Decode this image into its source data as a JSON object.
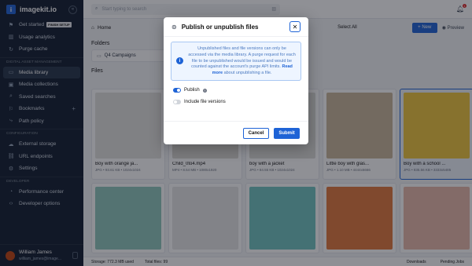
{
  "app": {
    "logo_letter": "i",
    "name": "imagekit.io"
  },
  "sidebar": {
    "items_top": [
      {
        "label": "Get started",
        "badge": "FINISH SETUP",
        "icon": "rocket-icon"
      },
      {
        "label": "Usage analytics",
        "icon": "chart-icon"
      },
      {
        "label": "Purge cache",
        "icon": "refresh-icon"
      }
    ],
    "section_dam": "DIGITAL ASSET MANAGEMENT",
    "items_dam": [
      {
        "label": "Media library",
        "icon": "folder-icon",
        "active": true
      },
      {
        "label": "Media collections",
        "icon": "collection-icon"
      },
      {
        "label": "Saved searches",
        "icon": "bookmark-search-icon"
      },
      {
        "label": "Bookmarks",
        "icon": "bookmark-icon",
        "plus": "+"
      },
      {
        "label": "Path policy",
        "icon": "path-icon"
      }
    ],
    "section_config": "CONFIGURATION",
    "items_config": [
      {
        "label": "External storage",
        "icon": "storage-icon"
      },
      {
        "label": "URL endpoints",
        "icon": "link-icon"
      },
      {
        "label": "Settings",
        "icon": "gear-icon"
      }
    ],
    "section_dev": "DEVELOPER",
    "items_dev": [
      {
        "label": "Performance center",
        "icon": "gauge-icon"
      },
      {
        "label": "Developer options",
        "icon": "code-icon"
      }
    ],
    "user": {
      "name": "William James",
      "email": "william_james@image..."
    }
  },
  "topbar": {
    "search_placeholder": "Start typing to search",
    "notifications": "1"
  },
  "toolbar": {
    "breadcrumb": "Home",
    "select_all": "Select All",
    "new_label": "New",
    "preview_label": "Preview"
  },
  "folders": {
    "title": "Folders",
    "items": [
      "Q4 Campaigns"
    ]
  },
  "files": {
    "title": "Files",
    "items": [
      {
        "name": "Boy with orange ja...",
        "meta": "JPG • 93.61 KB • 1024x1024",
        "color": "#e3e3df"
      },
      {
        "name": "Child_0to4.mp4",
        "meta": "MP4 • 8.54 MB • 1080x1920",
        "color": "#d8d6d1"
      },
      {
        "name": "boy with a jacket",
        "meta": "JPG • 84.55 KB • 1024x1024",
        "color": "#dcdcd8"
      },
      {
        "name": "Little boy with glas...",
        "meta": "JPG • 1.10 MB • 4444x6666",
        "color": "#c9b79a"
      },
      {
        "name": "Boy with a school ...",
        "meta": "JPG • 835.56 KB • 3333x5485",
        "color": "#efc63b",
        "selected": true
      },
      {
        "name": "",
        "meta": "",
        "color": "#8fc7bd"
      },
      {
        "name": "",
        "meta": "",
        "color": "#e6e7e6"
      },
      {
        "name": "",
        "meta": "",
        "color": "#6fc3c0"
      },
      {
        "name": "",
        "meta": "",
        "color": "#e2773a"
      },
      {
        "name": "",
        "meta": "",
        "color": "#e9b8a9"
      }
    ]
  },
  "statusbar": {
    "storage": "Storage: 772.3 MB used",
    "total": "Total files: 99",
    "downloads": "Downloads",
    "pending": "Pending Jobs"
  },
  "modal": {
    "title": "Publish or unpublish files",
    "info": "Unpublished files and file versions can only be accessed via the media library. A purge request for each file to be unpublished would be issued and would be counted against the account's purge API limits.",
    "info_link": "Read more",
    "info_tail": "about unpublishing a file.",
    "publish_label": "Publish",
    "include_versions_label": "Include file versions",
    "cancel_label": "Cancel",
    "submit_label": "Submit"
  },
  "colors": {
    "accent": "#1e63d6",
    "sidebar_bg": "#0f1a2c"
  }
}
